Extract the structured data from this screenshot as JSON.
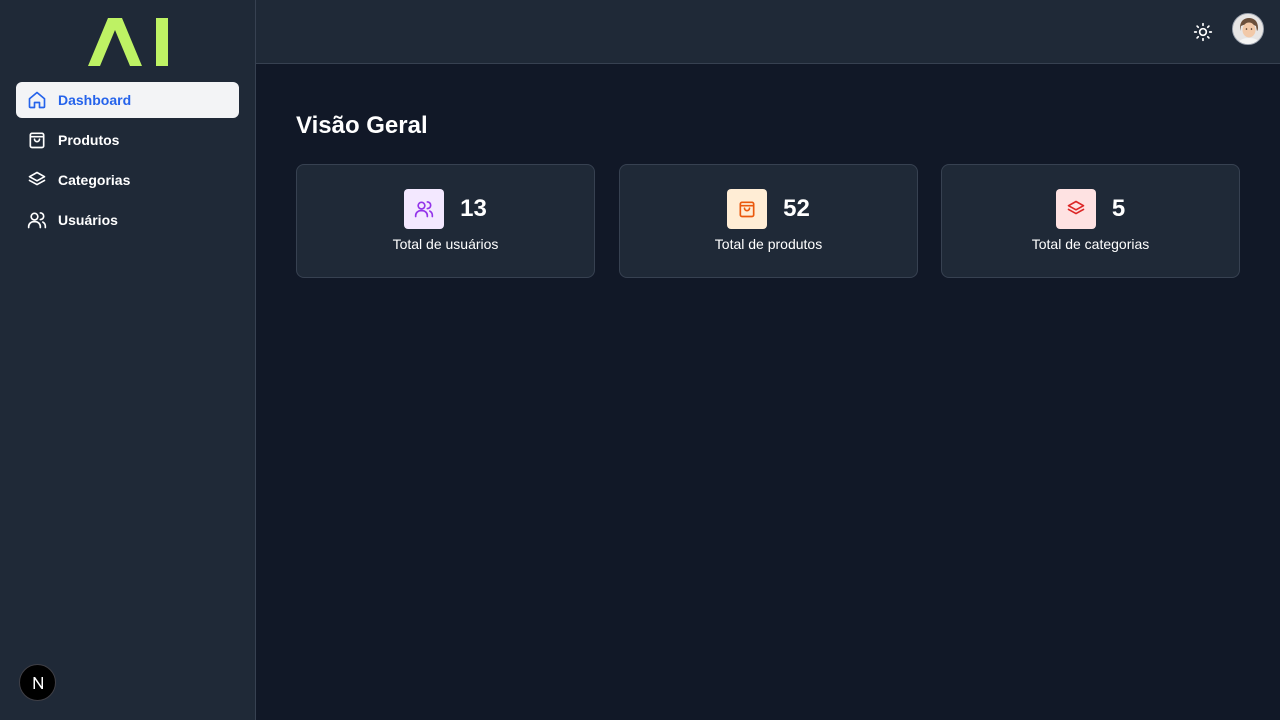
{
  "brand": {
    "logo_text": "AI",
    "logo_color": "#bef264"
  },
  "sidebar": {
    "items": [
      {
        "label": "Dashboard",
        "icon": "home-icon",
        "active": true
      },
      {
        "label": "Produtos",
        "icon": "shopping-bag-icon",
        "active": false
      },
      {
        "label": "Categorias",
        "icon": "layers-icon",
        "active": false
      },
      {
        "label": "Usuários",
        "icon": "users-icon",
        "active": false
      }
    ],
    "footer_badge": {
      "label": "N",
      "icon": "nextjs-logo-icon"
    }
  },
  "header": {
    "theme_icon": "sun-icon",
    "avatar_icon": "user-avatar"
  },
  "main": {
    "title": "Visão Geral",
    "stats": [
      {
        "value": "13",
        "label": "Total de usuários",
        "icon": "users-icon",
        "icon_bg": "#f3e8ff",
        "icon_color": "#9333ea"
      },
      {
        "value": "52",
        "label": "Total de produtos",
        "icon": "shopping-bag-icon",
        "icon_bg": "#ffedd5",
        "icon_color": "#ea580c"
      },
      {
        "value": "5",
        "label": "Total de categorias",
        "icon": "layers-icon",
        "icon_bg": "#fee2e2",
        "icon_color": "#dc2626"
      }
    ]
  },
  "colors": {
    "sidebar_bg": "#1f2937",
    "main_bg": "#111827",
    "active_item_bg": "#f3f4f6",
    "active_item_text": "#2563eb"
  }
}
